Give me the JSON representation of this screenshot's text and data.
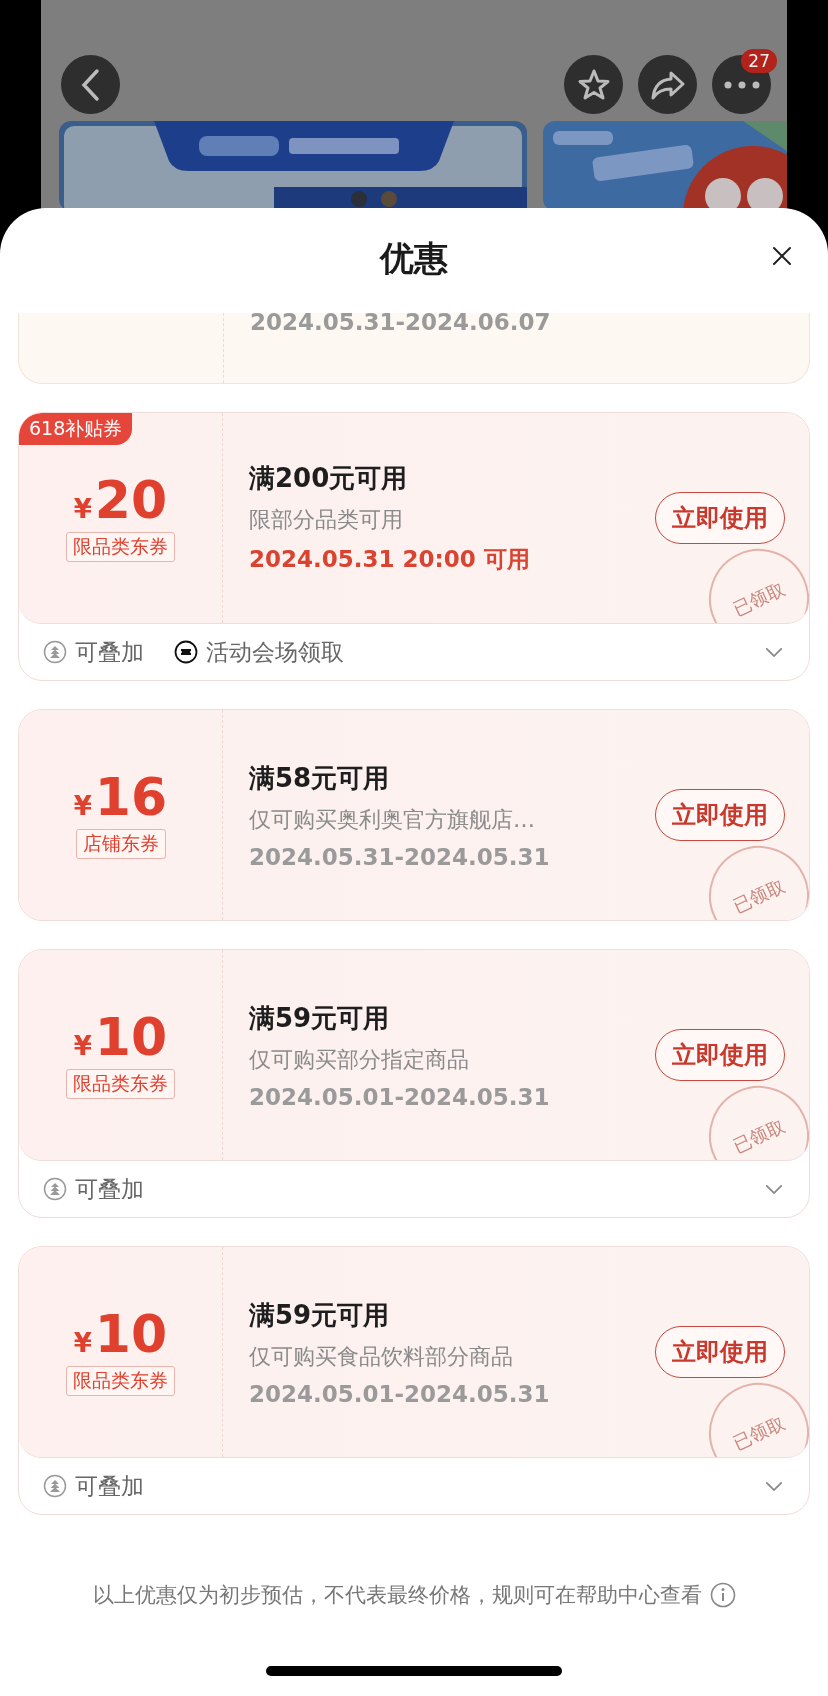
{
  "top_bar": {
    "badge": "27"
  },
  "sheet": {
    "title": "优惠"
  },
  "partial_coupon": {
    "date": "2024.05.31-2024.06.07"
  },
  "coupons": [
    {
      "tag": "618补贴券",
      "currency": "¥",
      "amount": "20",
      "type": "限品类东券",
      "condition": "满200元可用",
      "description": "限部分品类可用",
      "date": "2024.05.31 20:00 可用",
      "date_highlight": true,
      "button": "立即使用",
      "stamp": "已领取",
      "footer": {
        "items": [
          {
            "kind": "stackable",
            "label": "可叠加"
          },
          {
            "kind": "venue",
            "label": "活动会场领取"
          }
        ],
        "expanded": false
      }
    },
    {
      "currency": "¥",
      "amount": "16",
      "type": "店铺东券",
      "condition": "满58元可用",
      "description": "仅可购买奥利奥官方旗舰店…",
      "date": "2024.05.31-2024.05.31",
      "date_highlight": false,
      "button": "立即使用",
      "stamp": "已领取"
    },
    {
      "currency": "¥",
      "amount": "10",
      "type": "限品类东券",
      "condition": "满59元可用",
      "description": "仅可购买部分指定商品",
      "date": "2024.05.01-2024.05.31",
      "date_highlight": false,
      "button": "立即使用",
      "stamp": "已领取",
      "footer": {
        "items": [
          {
            "kind": "stackable",
            "label": "可叠加"
          }
        ],
        "expanded": false
      }
    },
    {
      "currency": "¥",
      "amount": "10",
      "type": "限品类东券",
      "condition": "满59元可用",
      "description": "仅可购买食品饮料部分商品",
      "date": "2024.05.01-2024.05.31",
      "date_highlight": false,
      "button": "立即使用",
      "stamp": "已领取",
      "footer": {
        "items": [
          {
            "kind": "stackable",
            "label": "可叠加"
          }
        ],
        "expanded": false
      }
    }
  ],
  "disclaimer": "以上优惠仅为初步预估，不代表最终价格，规则可在帮助中心查看"
}
